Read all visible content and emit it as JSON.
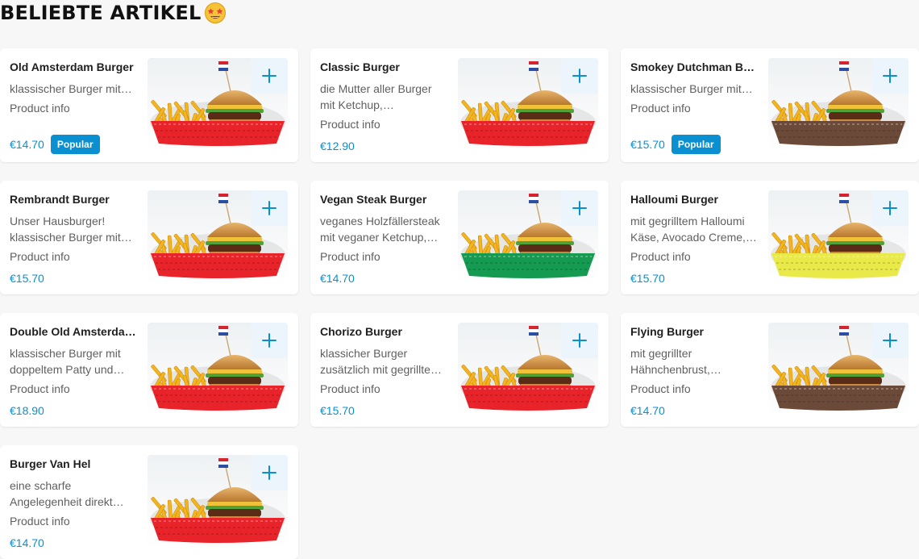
{
  "section": {
    "title": "BELIEBTE ARTIKEL",
    "emoji_icon": "star-struck-emoji-icon"
  },
  "colors": {
    "accent": "#0a8fd1",
    "add_button_bg": "#ebf5fb",
    "card_bg": "#ffffff",
    "page_bg": "#f7f7f7"
  },
  "items": [
    {
      "name": "Old Amsterdam Burger",
      "description": "klassischer Burger mit…",
      "info": "Product info",
      "price": "€14.70",
      "badge": "Popular",
      "basket_color": "#e8232a",
      "flag": true
    },
    {
      "name": "Classic Burger",
      "description": "die Mutter aller Burger mit Ketchup,…",
      "info": "Product info",
      "price": "€12.90",
      "badge": "",
      "basket_color": "#e8232a",
      "flag": true
    },
    {
      "name": "Smokey Dutchman Bu…",
      "description": "klassischer Burger mit…",
      "info": "Product info",
      "price": "€15.70",
      "badge": "Popular",
      "basket_color": "#6b4a3a",
      "flag": true
    },
    {
      "name": "Rembrandt Burger",
      "description": "Unser Hausburger! klassischer Burger mit…",
      "info": "Product info",
      "price": "€15.70",
      "badge": "",
      "basket_color": "#e8232a",
      "flag": true
    },
    {
      "name": "Vegan Steak Burger",
      "description": "veganes Holzfällersteak mit veganer Ketchup,…",
      "info": "Product info",
      "price": "€14.70",
      "badge": "",
      "basket_color": "#159a52",
      "flag": true
    },
    {
      "name": "Halloumi Burger",
      "description": "mit gegrilltem Halloumi Käse, Avocado Creme,…",
      "info": "Product info",
      "price": "€15.70",
      "badge": "",
      "basket_color": "#e9ea4a",
      "flag": true
    },
    {
      "name": "Double Old Amsterda…",
      "description": "klassischer Burger mit doppeltem Patty und…",
      "info": "Product info",
      "price": "€18.90",
      "badge": "",
      "basket_color": "#e8232a",
      "flag": true
    },
    {
      "name": "Chorizo Burger",
      "description": "klassicher Burger zusätzlich mit gegrillte…",
      "info": "Product info",
      "price": "€15.70",
      "badge": "",
      "basket_color": "#e8232a",
      "flag": true
    },
    {
      "name": "Flying Burger",
      "description": "mit gegrillter Hähnchenbrust,…",
      "info": "Product info",
      "price": "€14.70",
      "badge": "",
      "basket_color": "#6b4a3a",
      "flag": true
    },
    {
      "name": "Burger Van Hel",
      "description": "eine scharfe Angelegenheit direkt…",
      "info": "Product info",
      "price": "€14.70",
      "badge": "",
      "basket_color": "#e8232a",
      "flag": true
    }
  ]
}
